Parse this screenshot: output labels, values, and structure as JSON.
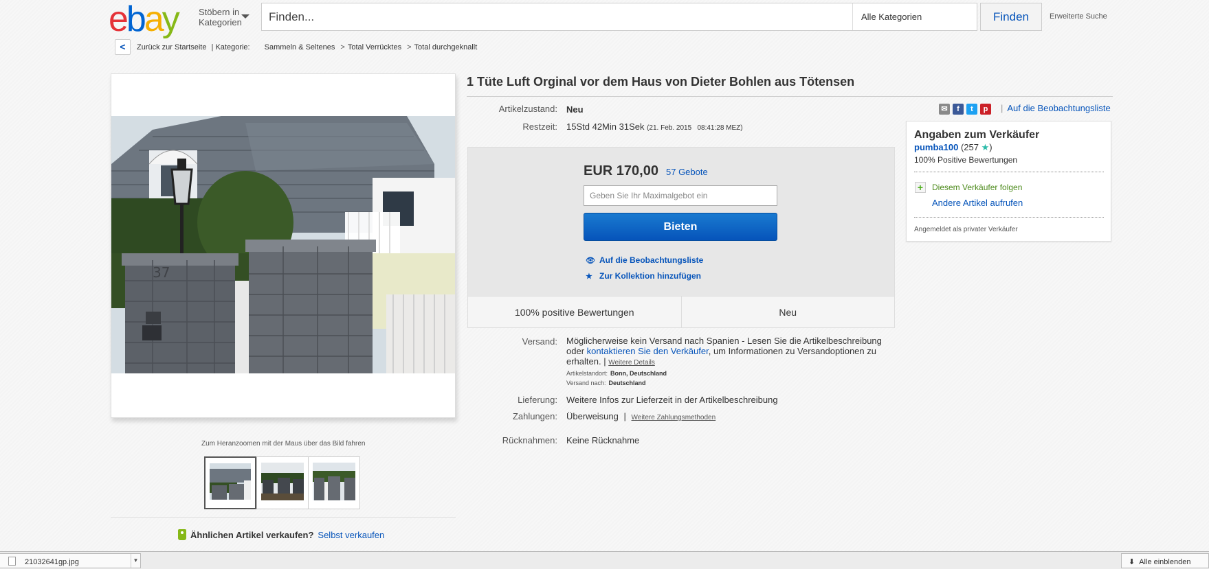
{
  "header": {
    "logo": "ebay",
    "browse_line1": "Stöbern in",
    "browse_line2": "Kategorien",
    "search_placeholder": "Finden...",
    "category": "Alle Kategorien",
    "search_button": "Finden",
    "advanced": "Erweiterte Suche"
  },
  "breadcrumb": {
    "back": "Zurück zur Startseite",
    "label": "| Kategorie:",
    "items": [
      "Sammeln & Seltenes",
      "Total Verrücktes",
      "Total durchgeknallt"
    ]
  },
  "gallery": {
    "zoom_hint": "Zum Heranzoomen mit der Maus über das Bild fahren",
    "sell_prompt": "Ähnlichen Artikel verkaufen?",
    "sell_link": "Selbst verkaufen"
  },
  "item": {
    "title": "1 Tüte Luft Orginal vor dem Haus von Dieter Bohlen aus Tötensen",
    "condition_label": "Artikelzustand:",
    "condition": "Neu",
    "time_label": "Restzeit:",
    "time_left": "15Std 42Min 31Sek",
    "end_date": "(21. Feb. 2015   08:41:28 MEZ)",
    "watch_link": "Auf die Beobachtungsliste"
  },
  "bid": {
    "price": "EUR 170,00",
    "bids": "57 Gebote",
    "max_bid_placeholder": "Geben Sie Ihr Maximalgebot ein",
    "bid_button": "Bieten",
    "watch": "Auf die Beobachtungsliste",
    "collection": "Zur Kollektion hinzufügen",
    "footer_left": "100% positive Bewertungen",
    "footer_right": "Neu"
  },
  "shipping": {
    "label": "Versand:",
    "text_1": "Möglicherweise kein Versand nach Spanien - Lesen Sie die Artikelbeschreibung oder",
    "contact_link": "kontaktieren Sie den Verkäufer",
    "text_2": ", um Informationen zu Versandoptionen zu erhalten.",
    "more": "Weitere Details",
    "location_label": "Artikelstandort:",
    "location": "Bonn, Deutschland",
    "ships_to_label": "Versand nach:",
    "ships_to": "Deutschland",
    "delivery_label": "Lieferung:",
    "delivery": "Weitere Infos zur Lieferzeit in der Artikelbeschreibung",
    "payment_label": "Zahlungen:",
    "payment": "Überweisung",
    "payment_more": "Weitere Zahlungsmethoden",
    "returns_label": "Rücknahmen:",
    "returns": "Keine Rücknahme"
  },
  "seller": {
    "title": "Angaben zum Verkäufer",
    "name": "pumba100",
    "score": "(257",
    "score_close": ")",
    "positive": "100% Positive Bewertungen",
    "follow": "Diesem Verkäufer folgen",
    "other_items": "Andere Artikel aufrufen",
    "private": "Angemeldet als privater Verkäufer"
  },
  "downloads": {
    "file": "21032641gp.jpg",
    "show_all": "Alle einblenden"
  }
}
